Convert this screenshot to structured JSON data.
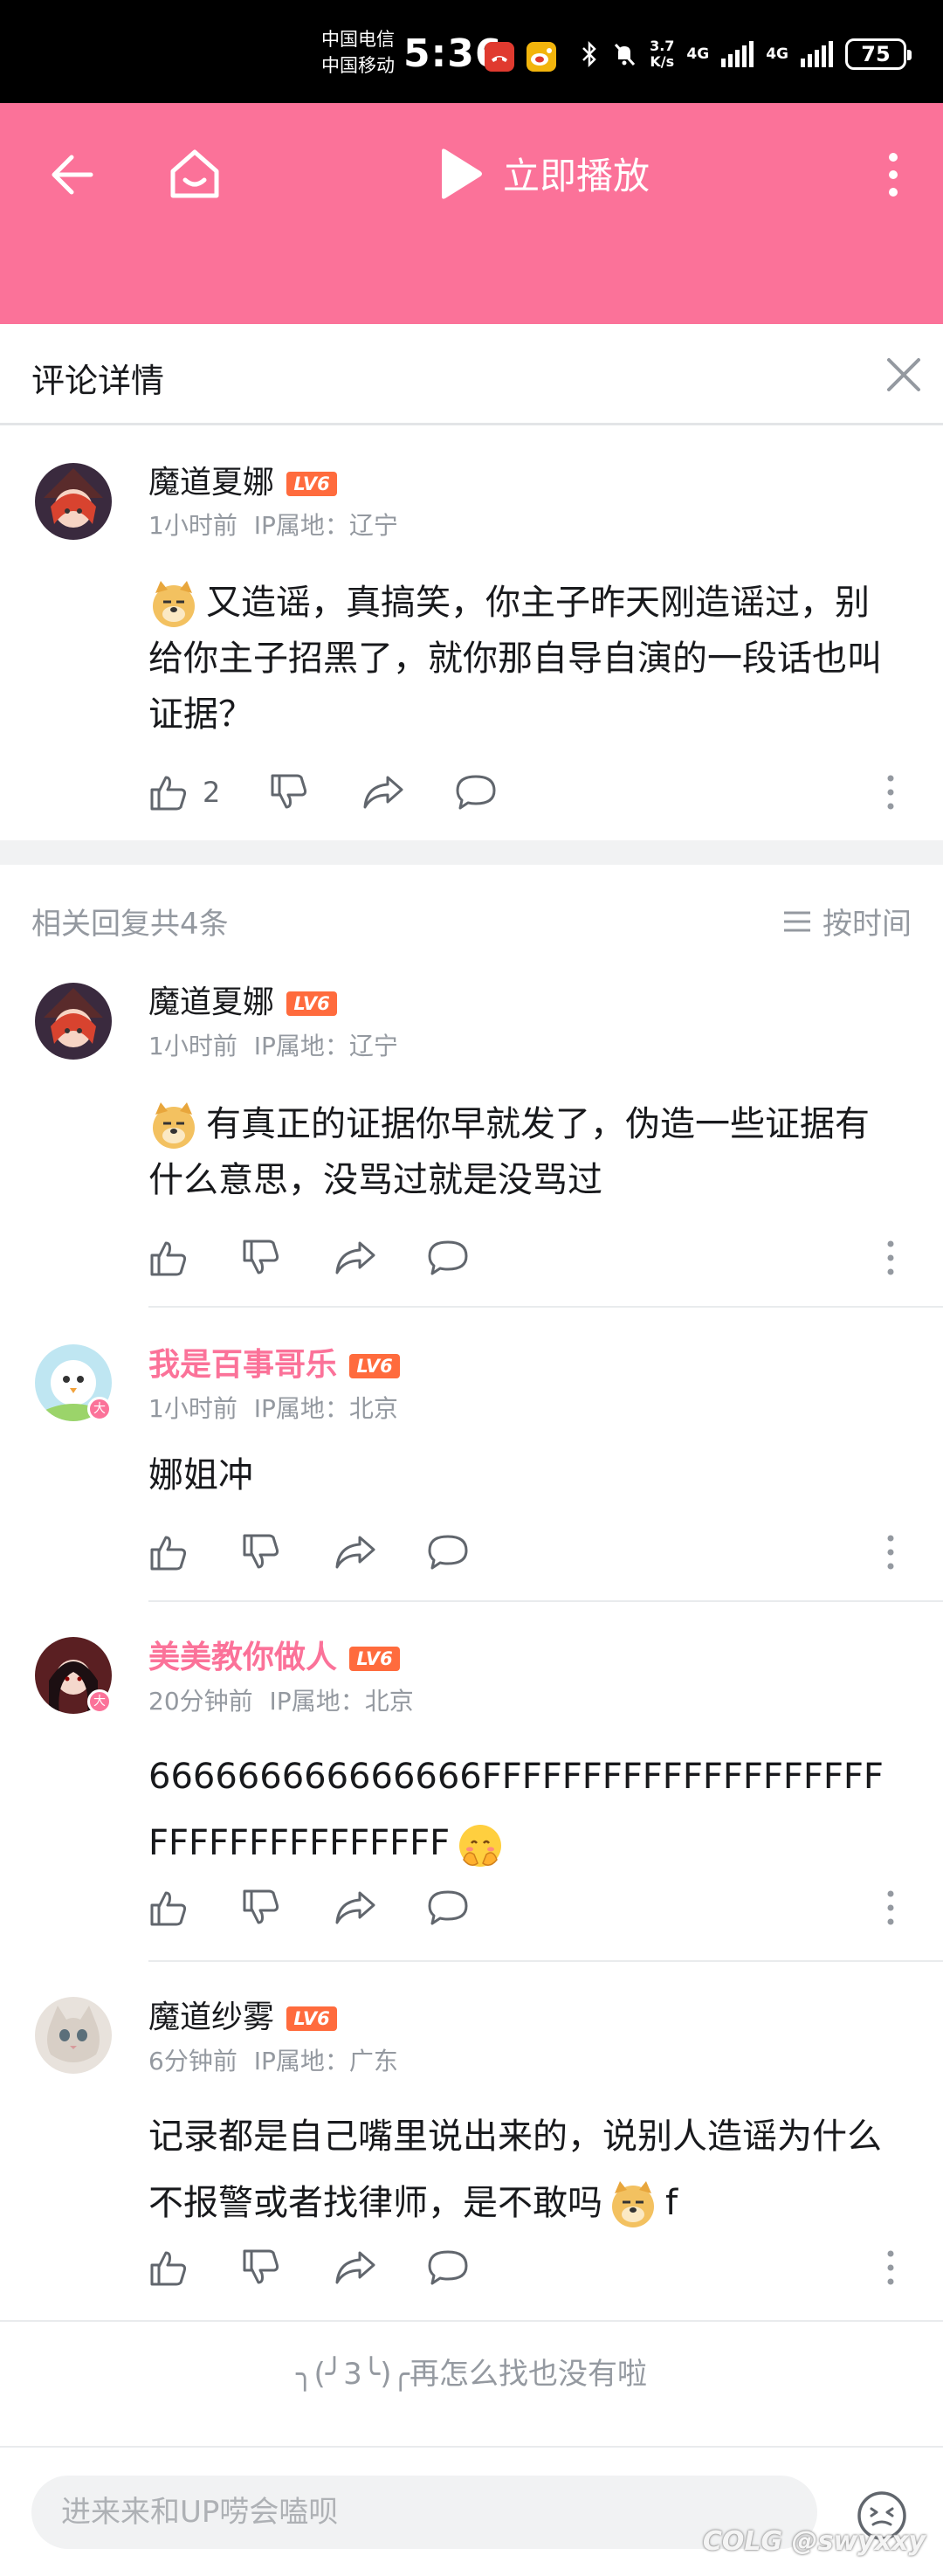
{
  "status_bar": {
    "carrier1": "中国电信",
    "carrier2": "中国移动",
    "time": "5:36",
    "speed_top": "3.7",
    "speed_bottom": "K/s",
    "net1": "4G",
    "net2": "4G",
    "battery": "75"
  },
  "header": {
    "play_label": "立即播放",
    "bg_color": "#fb7299"
  },
  "title_bar": {
    "title": "评论详情"
  },
  "root_comment": {
    "username": "魔道夏娜",
    "level": "LV6",
    "time": "1小时前",
    "ip": "IP属地：辽宁",
    "text": "又造谣，真搞笑，你主子昨天刚造谣过，别给你主子招黑了，就你那自导自演的一段话也叫证据？",
    "likes": "2"
  },
  "replies_header": {
    "count_label": "相关回复共4条",
    "sort_label": "按时间"
  },
  "replies": [
    {
      "username": "魔道夏娜",
      "level": "LV6",
      "time": "1小时前",
      "ip": "IP属地：辽宁",
      "text": "有真正的证据你早就发了，伪造一些证据有什么意思，没骂过就是没骂过"
    },
    {
      "username": "我是百事哥乐",
      "level": "LV6",
      "time": "1小时前",
      "ip": "IP属地：北京",
      "text": "娜姐冲",
      "badge": "大"
    },
    {
      "username": "美美教你做人",
      "level": "LV6",
      "time": "20分钟前",
      "ip": "IP属地：北京",
      "text": "666666666666666FFFFFFFFFFFFFFFFFFFFFFFFFFFFFFFFFFF",
      "badge": "大"
    },
    {
      "username": "魔道纱雾",
      "level": "LV6",
      "time": "6分钟前",
      "ip": "IP属地：广东",
      "text": "记录都是自己嘴里说出来的，说别人造谣为什么不报警或者找律师，是不敢吗",
      "text_tail": "f"
    }
  ],
  "end_note": "╮(╯3╰)╭再怎么找也没有啦",
  "composer": {
    "placeholder": "进来来和UP唠会嗑呗",
    "watermark": "COLG @swyxxy"
  }
}
